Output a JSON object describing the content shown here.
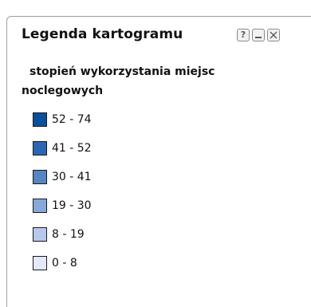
{
  "window": {
    "title": "Legenda kartogramu",
    "help_label": "?"
  },
  "legend": {
    "subtitle_line1": "stopień wykorzystania miejsc",
    "subtitle_line2": "noclegowych",
    "items": [
      {
        "label": "52 - 74",
        "color": "#0b4f9c"
      },
      {
        "label": "41 - 52",
        "color": "#2a67b2"
      },
      {
        "label": "30 - 41",
        "color": "#5585c4"
      },
      {
        "label": "19 - 30",
        "color": "#86a9da"
      },
      {
        "label": "8 - 19",
        "color": "#b7c8ec"
      },
      {
        "label": "0 - 8",
        "color": "#e3e9fa"
      }
    ]
  },
  "icons": {
    "help": "help-icon",
    "minimize": "minimize-icon",
    "close": "close-icon"
  }
}
